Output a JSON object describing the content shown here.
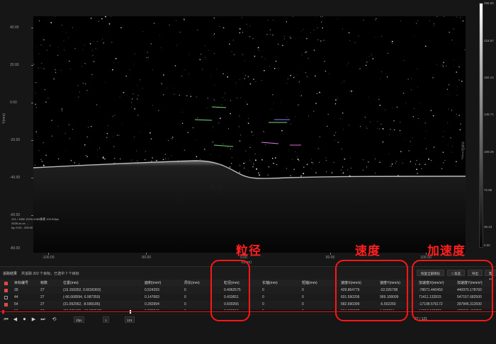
{
  "viewer": {
    "y_ticks": [
      "40.00",
      "20.00",
      "0.00",
      "-20.00",
      "-40.00",
      "-60.00",
      "-80.00"
    ],
    "x_ticks": [
      "-100.00",
      "-50.00",
      "0.00",
      "50.00",
      "100.00"
    ],
    "y_axis_label": "Y(mm)",
    "x_axis_label": "X(mm)",
    "overlay_label": "粒径",
    "scale_info": [
      "121 / 1980  1920×1080像素  100.00fps",
      "2026-xx-xx  ...",
      "bg: 0.00 - 255.00"
    ],
    "colorbar_ticks": [
      "255.00",
      "218.57",
      "182.14",
      "145.71",
      "109.29",
      "72.86",
      "36.43",
      "0.00"
    ],
    "colorbar_title": "灰度值(Gray)"
  },
  "annotations": {
    "particle_size": "粒径",
    "velocity": "速度",
    "acceleration": "加速度",
    "color": "#ff1f1f"
  },
  "panel": {
    "title": "追踪结果",
    "summary": "共追踪 202 个目标，已选中 7 个目标",
    "buttons": [
      "恢复全部目标",
      "□ 高选",
      "导出",
      "帮助"
    ]
  },
  "table": {
    "headers": [
      "目标编号",
      "帧数",
      "位置(mm)",
      "面积(mm²)",
      "周长(mm)",
      "粒径(mm)",
      "长轴(mm)",
      "短轴(mm)",
      "速度X(mm/s)",
      "速度Y(mm/s)",
      "加速度X(mm/s²)",
      "加速度Y(mm/s²)"
    ],
    "rows": [
      {
        "checked": true,
        "cells": [
          "39",
          "27",
          "(16.159262, 0.6636360)",
          "0.524293",
          "0",
          "0.4962575",
          "0",
          "0",
          "429.864779",
          "-32.026798",
          "-78671.440450",
          "440970.178760"
        ]
      },
      {
        "checked": false,
        "cells": [
          "44",
          "27",
          "(-66.668594, 6.987359)",
          "0.147683",
          "0",
          "0.433651",
          "0",
          "0",
          "601.590206",
          "969.108009",
          "71411.132815",
          "547157.682500"
        ]
      },
      {
        "checked": true,
        "cells": [
          "54",
          "27",
          "(31.092962, -8.589186)",
          "0.282994",
          "0",
          "0.600266",
          "0",
          "0",
          "582.690399",
          "-6.502260",
          "-17198.576172",
          "397845.312500"
        ]
      },
      {
        "checked": true,
        "cells": [
          "56",
          "27",
          "(26.971678, -10.330573)",
          "0.270046",
          "0",
          "0.586916",
          "0",
          "0",
          "584.533632",
          "1.092911",
          "14718.126709",
          "378696.406250"
        ]
      },
      {
        "checked": true,
        "cells": [
          "71",
          "27",
          "(24.704041, -21.609612)",
          "0.360995",
          "0",
          "0.677586",
          "0",
          "0",
          "574.883626",
          "-5.702972",
          "-4825.669434",
          "361104.937500"
        ]
      },
      {
        "checked": true,
        "cells": [
          "75",
          "27",
          "(-1.078600, -23.124590)",
          "0.186513",
          "0",
          "0.486986",
          "0",
          "0",
          "572.922494",
          "-17.041901",
          "-39339.531250",
          "357465.250000"
        ]
      }
    ]
  },
  "player": {
    "buttons": [
      "⏮",
      "◀",
      "⏺",
      "▶",
      "⏭",
      "⟲"
    ],
    "speed": "1fps",
    "frame_from": "1",
    "frame_to": "121",
    "time": "27 / 121"
  }
}
